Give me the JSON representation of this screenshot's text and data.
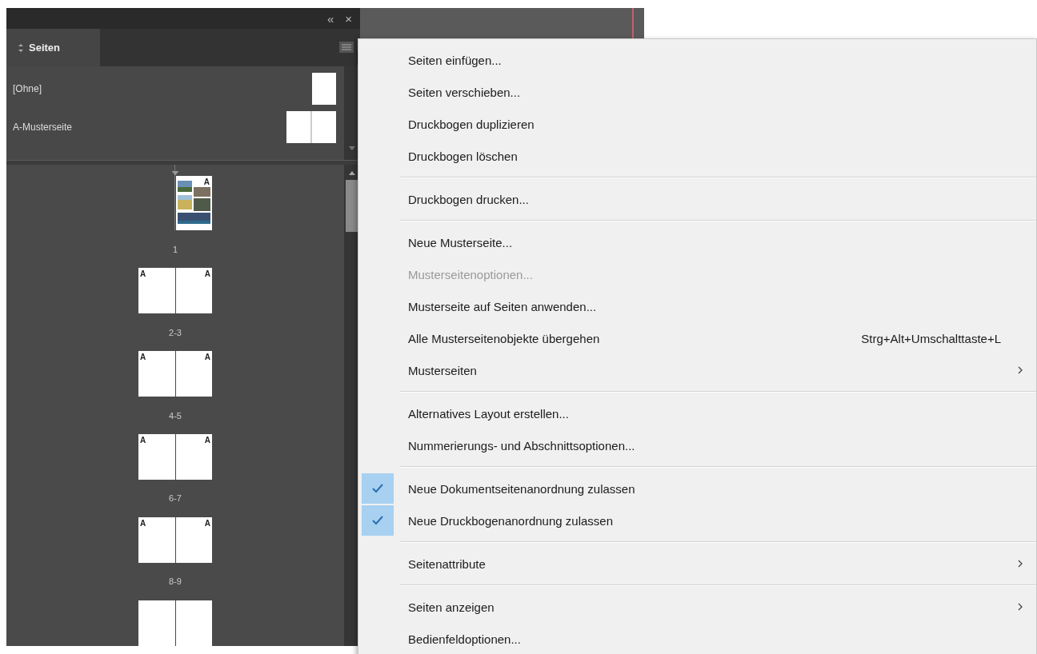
{
  "panel": {
    "header": {
      "collapse": "«",
      "close": "×"
    },
    "tab": {
      "label": "Seiten",
      "selected": true
    },
    "masters": [
      {
        "label": "[Ohne]",
        "kind": "single"
      },
      {
        "label": "A-Musterseite",
        "kind": "spread"
      }
    ],
    "pages": [
      {
        "kind": "single",
        "label": "1",
        "masters": [
          "A"
        ],
        "picture": true
      },
      {
        "kind": "spread",
        "label": "2-3",
        "masters": [
          "A",
          "A"
        ]
      },
      {
        "kind": "spread",
        "label": "4-5",
        "masters": [
          "A",
          "A"
        ]
      },
      {
        "kind": "spread",
        "label": "6-7",
        "masters": [
          "A",
          "A"
        ]
      },
      {
        "kind": "spread",
        "label": "8-9",
        "masters": [
          "A",
          "A"
        ]
      },
      {
        "kind": "spread"
      }
    ]
  },
  "menu": {
    "sections": [
      [
        {
          "label": "Seiten einfügen...",
          "disabled": false,
          "checked": false,
          "submenu": false
        },
        {
          "label": "Seiten verschieben...",
          "disabled": false,
          "checked": false,
          "submenu": false
        },
        {
          "label": "Druckbogen duplizieren",
          "disabled": false,
          "checked": false,
          "submenu": false
        },
        {
          "label": "Druckbogen löschen",
          "disabled": false,
          "checked": false,
          "submenu": false
        }
      ],
      [
        {
          "label": "Druckbogen drucken...",
          "disabled": false,
          "checked": false,
          "submenu": false
        }
      ],
      [
        {
          "label": "Neue Musterseite...",
          "disabled": false,
          "checked": false,
          "submenu": false
        },
        {
          "label": "Musterseitenoptionen...",
          "disabled": true,
          "checked": false,
          "submenu": false
        },
        {
          "label": "Musterseite auf Seiten anwenden...",
          "disabled": false,
          "checked": false,
          "submenu": false
        },
        {
          "label": "Alle Musterseitenobjekte übergehen",
          "shortcut": "Strg+Alt+Umschalttaste+L",
          "disabled": false,
          "checked": false,
          "submenu": false
        },
        {
          "label": "Musterseiten",
          "disabled": false,
          "checked": false,
          "submenu": true
        }
      ],
      [
        {
          "label": "Alternatives Layout erstellen...",
          "disabled": false,
          "checked": false,
          "submenu": false
        },
        {
          "label": "Nummerierungs- und Abschnittsoptionen...",
          "disabled": false,
          "checked": false,
          "submenu": false
        }
      ],
      [
        {
          "label": "Neue Dokumentseitenanordnung zulassen",
          "disabled": false,
          "checked": true,
          "submenu": false
        },
        {
          "label": "Neue Druckbogenanordnung zulassen",
          "disabled": false,
          "checked": true,
          "submenu": false
        }
      ],
      [
        {
          "label": "Seitenattribute",
          "disabled": false,
          "checked": false,
          "submenu": true
        }
      ],
      [
        {
          "label": "Seiten anzeigen",
          "disabled": false,
          "checked": false,
          "submenu": true
        },
        {
          "label": "Bedienfeldoptionen...",
          "disabled": false,
          "checked": false,
          "submenu": false
        }
      ]
    ]
  }
}
